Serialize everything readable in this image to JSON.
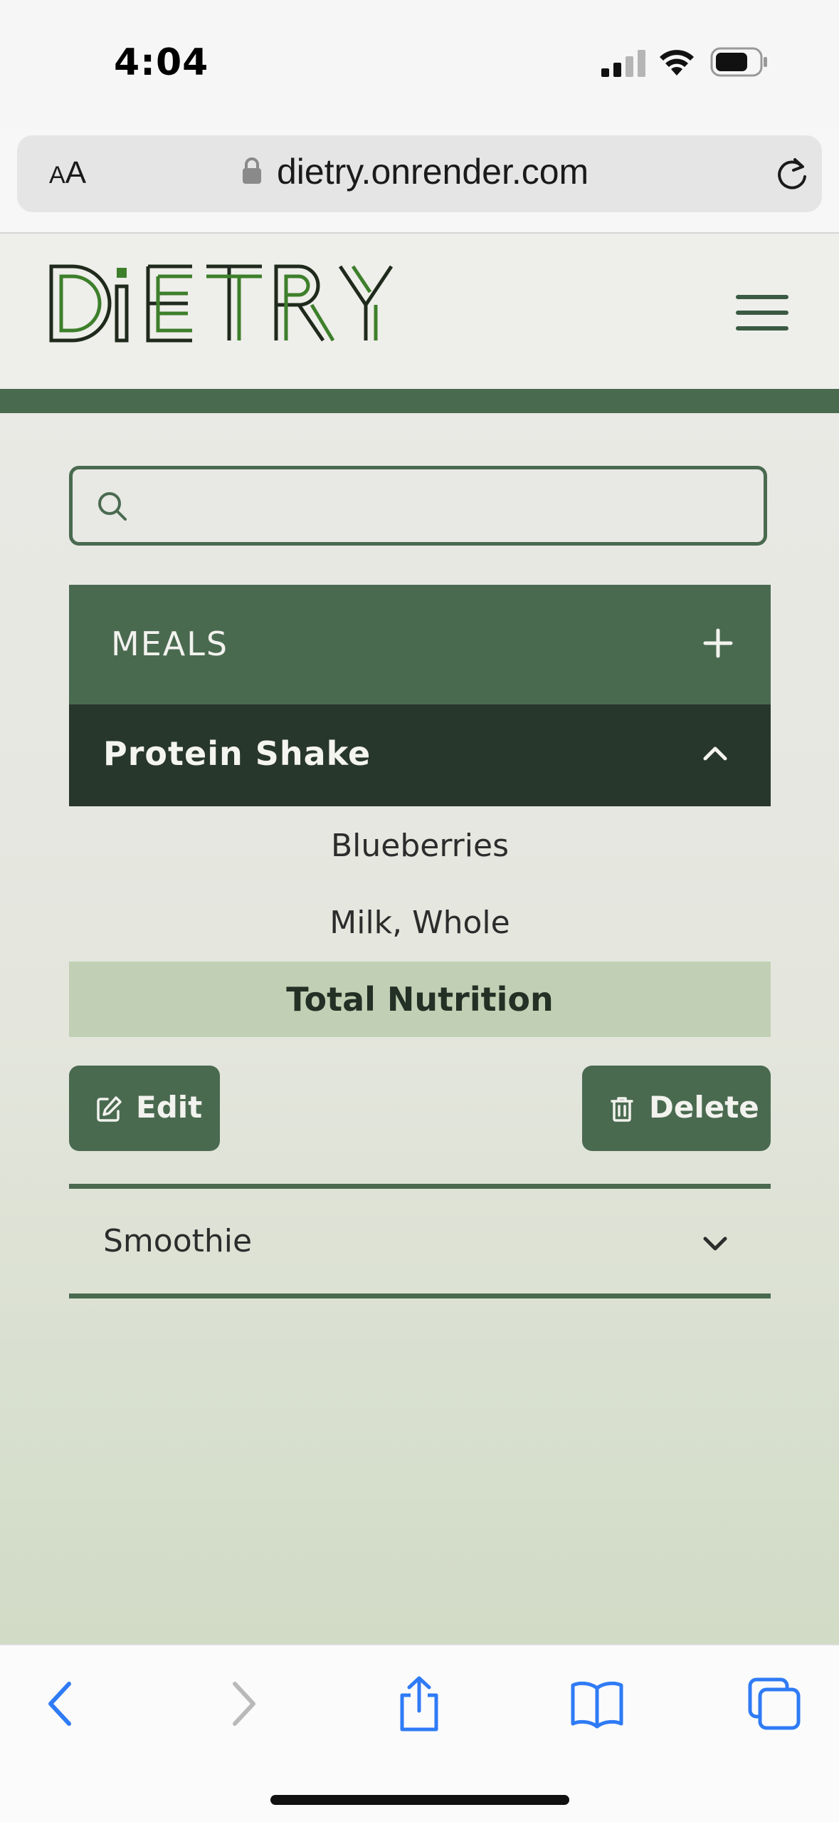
{
  "status_bar": {
    "time": "4:04"
  },
  "browser": {
    "text_size_label_small": "A",
    "text_size_label_large": "A",
    "url": "dietry.onrender.com"
  },
  "site": {
    "logo_text": "DiETRY"
  },
  "search": {
    "placeholder": "",
    "value": ""
  },
  "meals": {
    "section_title": "MEALS",
    "expanded_meal": {
      "name": "Protein Shake",
      "ingredients": [
        "Blueberries",
        "Milk, Whole"
      ],
      "total_label": "Total Nutrition",
      "edit_label": "Edit",
      "delete_label": "Delete"
    },
    "collapsed_meals": [
      {
        "name": "Smoothie"
      }
    ]
  },
  "colors": {
    "primary_green": "#4a6a50",
    "dark_green": "#28372b",
    "light_green": "#c1d0b4",
    "logo_green": "#2f6e22",
    "ios_blue": "#2f7bf5"
  },
  "icons": {
    "lock": "lock-icon",
    "reload": "reload-icon",
    "menu": "hamburger-menu-icon",
    "search": "search-icon",
    "add": "plus-icon",
    "collapse": "chevron-up-icon",
    "expand": "chevron-down-icon",
    "edit": "edit-icon",
    "delete": "trash-icon",
    "back": "back-icon",
    "forward": "forward-icon",
    "share": "share-icon",
    "bookmarks": "bookmarks-icon",
    "tabs": "tabs-icon"
  }
}
